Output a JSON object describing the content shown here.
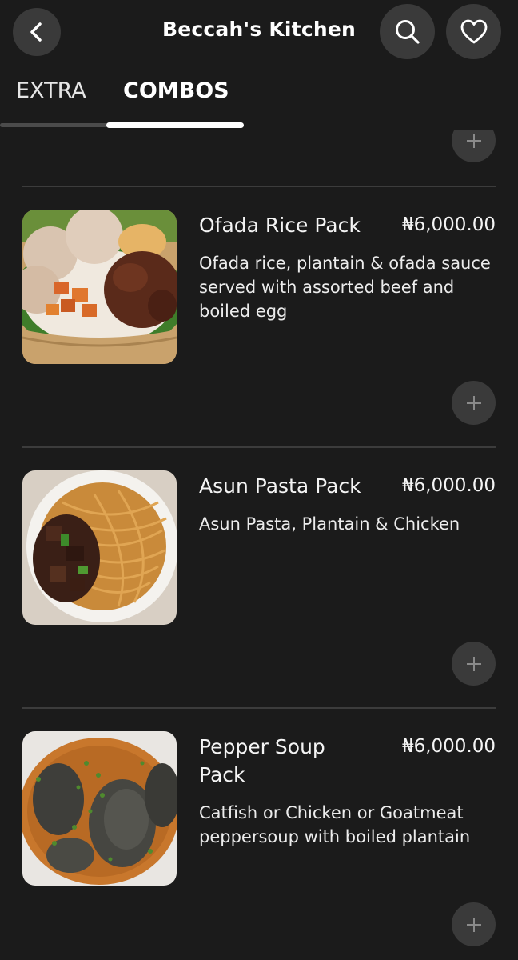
{
  "header": {
    "title": "Beccah's Kitchen",
    "back_icon": "chevron-left-icon",
    "search_icon": "search-icon",
    "favorite_icon": "heart-icon"
  },
  "tabs": [
    {
      "label": "EXTRA",
      "active": false
    },
    {
      "label": "COMBOS",
      "active": true
    }
  ],
  "menu_items": [
    {
      "name": "Ofada Rice Pack",
      "price": "₦6,000.00",
      "description": "Ofada rice, plantain & ofada sauce served with assorted beef and boiled egg"
    },
    {
      "name": "Asun Pasta Pack",
      "price": "₦6,000.00",
      "description": "Asun Pasta, Plantain & Chicken"
    },
    {
      "name": "Pepper Soup Pack",
      "price": "₦6,000.00",
      "description": "Catfish or Chicken or Goatmeat peppersoup with boiled plantain"
    }
  ],
  "colors": {
    "background": "#1b1b1b",
    "button": "#3a3a3a",
    "divider": "#3c3c3c",
    "text": "#ffffff"
  }
}
